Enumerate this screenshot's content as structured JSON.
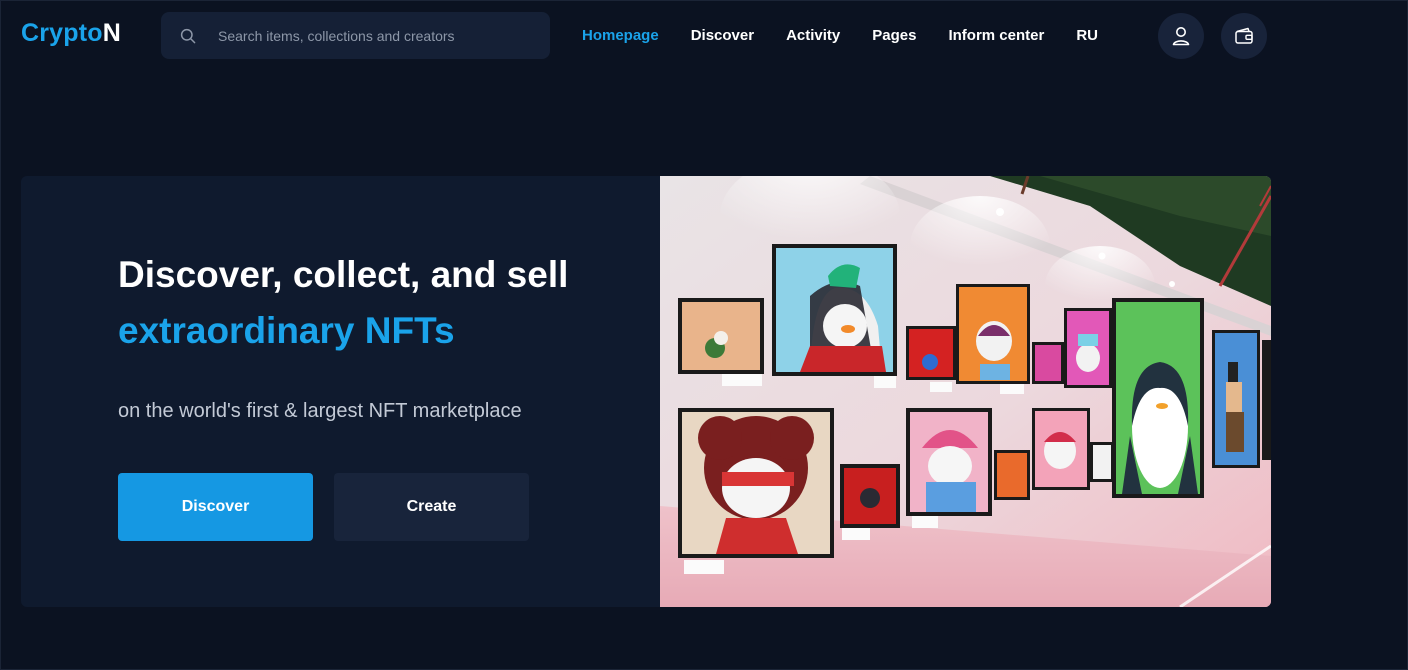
{
  "header": {
    "logo_part1": "Crypto",
    "logo_part2": "N",
    "search_placeholder": "Search items, collections and creators",
    "nav": [
      {
        "label": "Homepage",
        "active": true
      },
      {
        "label": "Discover",
        "active": false
      },
      {
        "label": "Activity",
        "active": false
      },
      {
        "label": "Pages",
        "active": false
      },
      {
        "label": "Inform center",
        "active": false
      },
      {
        "label": "RU",
        "active": false
      }
    ],
    "icons": {
      "search": "search-icon",
      "user": "user-icon",
      "wallet": "wallet-icon"
    }
  },
  "hero": {
    "title_line1": "Discover, collect, and sell",
    "title_line2": "extraordinary NFTs",
    "subtitle": "on the world's first & largest NFT marketplace",
    "primary_button": "Discover",
    "secondary_button": "Create"
  },
  "colors": {
    "background": "#0b1221",
    "panel": "#0f1a2e",
    "accent": "#1aa3ea",
    "button_primary": "#1598e3",
    "button_secondary": "#18243b"
  }
}
